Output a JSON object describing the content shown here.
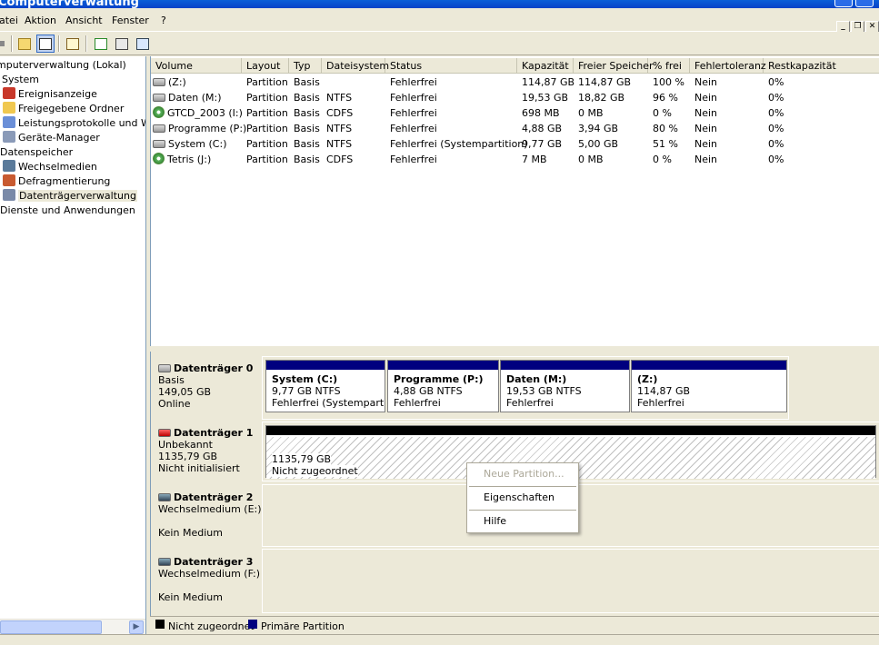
{
  "window": {
    "title": "Computerverwaltung"
  },
  "menu": {
    "items": [
      "atei",
      "Aktion",
      "Ansicht",
      "Fenster",
      "?"
    ]
  },
  "mdi": {
    "min": "_",
    "restore": "❐",
    "close": "✕"
  },
  "tree": {
    "items": [
      "mputerverwaltung (Lokal)",
      "System",
      "Ereignisanzeige",
      "Freigegebene Ordner",
      "Leistungsprotokolle und Warn",
      "Geräte-Manager",
      "Datenspeicher",
      "Wechselmedien",
      "Defragmentierung",
      "Datenträgerverwaltung",
      "Dienste und Anwendungen"
    ]
  },
  "volumes": {
    "columns": [
      "Volume",
      "Layout",
      "Typ",
      "Dateisystem",
      "Status",
      "Kapazität",
      "Freier Speicher",
      "% frei",
      "Fehlertoleranz",
      "Restkapazität"
    ],
    "rows": [
      [
        "(Z:)",
        "Partition",
        "Basis",
        "",
        "Fehlerfrei",
        "114,87 GB",
        "114,87 GB",
        "100 %",
        "Nein",
        "0%"
      ],
      [
        "Daten (M:)",
        "Partition",
        "Basis",
        "NTFS",
        "Fehlerfrei",
        "19,53 GB",
        "18,82 GB",
        "96 %",
        "Nein",
        "0%"
      ],
      [
        "GTCD_2003 (I:)",
        "Partition",
        "Basis",
        "CDFS",
        "Fehlerfrei",
        "698 MB",
        "0 MB",
        "0 %",
        "Nein",
        "0%"
      ],
      [
        "Programme (P:)",
        "Partition",
        "Basis",
        "NTFS",
        "Fehlerfrei",
        "4,88 GB",
        "3,94 GB",
        "80 %",
        "Nein",
        "0%"
      ],
      [
        "System (C:)",
        "Partition",
        "Basis",
        "NTFS",
        "Fehlerfrei (Systempartition)",
        "9,77 GB",
        "5,00 GB",
        "51 %",
        "Nein",
        "0%"
      ],
      [
        "Tetris (J:)",
        "Partition",
        "Basis",
        "CDFS",
        "Fehlerfrei",
        "7 MB",
        "0 MB",
        "0 %",
        "Nein",
        "0%"
      ]
    ]
  },
  "disks": [
    {
      "name": "Datenträger 0",
      "l1": "Basis",
      "l2": "149,05 GB",
      "l3": "Online"
    },
    {
      "name": "Datenträger 1",
      "l1": "Unbekannt",
      "l2": "1135,79 GB",
      "l3": "Nicht initialisiert"
    },
    {
      "name": "Datenträger 2",
      "l1": "Wechselmedium (E:)",
      "l2": "",
      "l3": "Kein Medium"
    },
    {
      "name": "Datenträger 3",
      "l1": "Wechselmedium (F:)",
      "l2": "",
      "l3": "Kein Medium"
    }
  ],
  "partitions": [
    {
      "name": "System  (C:)",
      "size": "9,77 GB NTFS",
      "status": "Fehlerfrei (Systempartition)"
    },
    {
      "name": "Programme  (P:)",
      "size": "4,88 GB NTFS",
      "status": "Fehlerfrei"
    },
    {
      "name": "Daten  (M:)",
      "size": "19,53 GB NTFS",
      "status": "Fehlerfrei"
    },
    {
      "name": " (Z:)",
      "size": "114,87 GB",
      "status": "Fehlerfrei"
    }
  ],
  "unallocated": {
    "size": "1135,79 GB",
    "label": "Nicht zugeordnet"
  },
  "context_menu": {
    "items": [
      "Neue Partition...",
      "Eigenschaften",
      "Hilfe"
    ]
  },
  "legend": {
    "unallocated": "Nicht zugeordnet",
    "primary": "Primäre Partition",
    "unallocated_color": "#000000",
    "primary_color": "#00007f"
  }
}
